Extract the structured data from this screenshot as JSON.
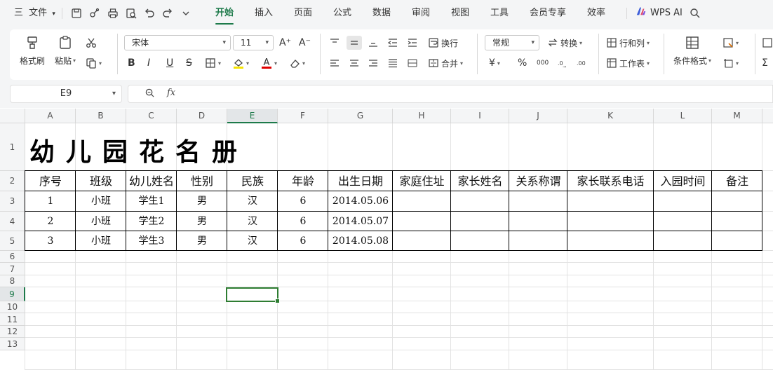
{
  "menu": {
    "hamburger": "三",
    "file": "文件",
    "tabs": [
      {
        "label": "开始",
        "active": true
      },
      {
        "label": "插入",
        "active": false
      },
      {
        "label": "页面",
        "active": false
      },
      {
        "label": "公式",
        "active": false
      },
      {
        "label": "数据",
        "active": false
      },
      {
        "label": "审阅",
        "active": false
      },
      {
        "label": "视图",
        "active": false
      },
      {
        "label": "工具",
        "active": false
      },
      {
        "label": "会员专享",
        "active": false
      },
      {
        "label": "效率",
        "active": false
      }
    ],
    "wps_ai": "WPS AI",
    "accent": "#1d7a4a"
  },
  "ribbon": {
    "format_painter": "格式刷",
    "paste": "粘贴",
    "font_name": "宋体",
    "font_size": "11",
    "bold": "B",
    "italic": "I",
    "underline": "U",
    "strike": "S",
    "wrap": "换行",
    "merge": "合并",
    "number_format": "常规",
    "convert": "转换",
    "rows_cols": "行和列",
    "worksheet": "工作表",
    "cond_format": "条件格式",
    "currency": "¥",
    "percent": "%",
    "thousands": "000",
    "font_grow": "A⁺",
    "font_shrink": "A⁻",
    "font_color_sample": "A"
  },
  "formula_bar": {
    "name_box": "E9",
    "fx": "fx",
    "value": ""
  },
  "sheet": {
    "columns": [
      "A",
      "B",
      "C",
      "D",
      "E",
      "F",
      "G",
      "H",
      "I",
      "J",
      "K",
      "L",
      "M"
    ],
    "selected_column": "E",
    "rows": [
      "1",
      "2",
      "3",
      "4",
      "5",
      "6",
      "7",
      "8",
      "9",
      "10",
      "11",
      "12",
      "13"
    ],
    "selected_row": "9",
    "title": "幼儿园花名册",
    "headers": [
      "序号",
      "班级",
      "幼儿姓名",
      "性别",
      "民族",
      "年龄",
      "出生日期",
      "家庭住址",
      "家长姓名",
      "关系称谓",
      "家长联系电话",
      "入园时间",
      "备注"
    ],
    "data": [
      [
        "1",
        "小班",
        "学生1",
        "男",
        "汉",
        "6",
        "2014.05.06",
        "",
        "",
        "",
        "",
        "",
        ""
      ],
      [
        "2",
        "小班",
        "学生2",
        "男",
        "汉",
        "6",
        "2014.05.07",
        "",
        "",
        "",
        "",
        "",
        ""
      ],
      [
        "3",
        "小班",
        "学生3",
        "男",
        "汉",
        "6",
        "2014.05.08",
        "",
        "",
        "",
        "",
        "",
        ""
      ]
    ],
    "active_cell": "E9",
    "selection_color": "#2e7d32"
  }
}
